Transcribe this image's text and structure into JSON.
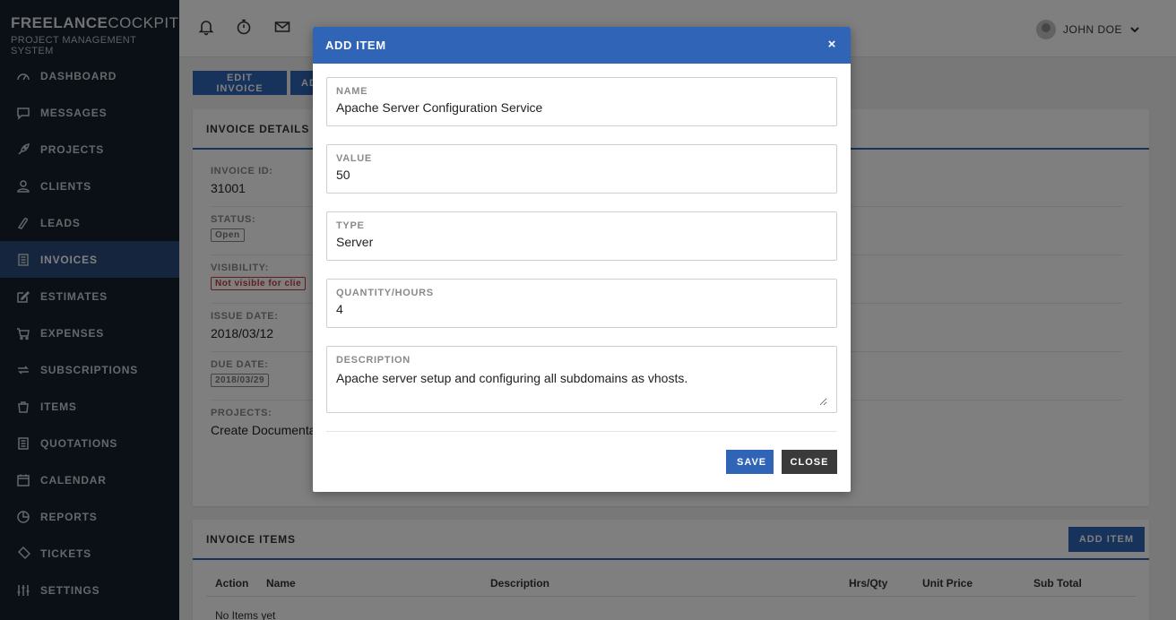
{
  "brand": {
    "title_bold": "FREELANCE",
    "title_rest": "COCKPIT",
    "subtitle": "PROJECT MANAGEMENT SYSTEM"
  },
  "sidebar": {
    "items": [
      {
        "label": "DASHBOARD",
        "icon": "gauge-icon"
      },
      {
        "label": "MESSAGES",
        "icon": "message-icon"
      },
      {
        "label": "PROJECTS",
        "icon": "rocket-icon"
      },
      {
        "label": "CLIENTS",
        "icon": "user-icon"
      },
      {
        "label": "LEADS",
        "icon": "leads-icon"
      },
      {
        "label": "INVOICES",
        "icon": "invoice-icon",
        "active": true
      },
      {
        "label": "ESTIMATES",
        "icon": "edit-icon"
      },
      {
        "label": "EXPENSES",
        "icon": "cart-icon"
      },
      {
        "label": "SUBSCRIPTIONS",
        "icon": "repeat-icon"
      },
      {
        "label": "ITEMS",
        "icon": "bag-icon"
      },
      {
        "label": "QUOTATIONS",
        "icon": "document-icon"
      },
      {
        "label": "CALENDAR",
        "icon": "calendar-icon"
      },
      {
        "label": "REPORTS",
        "icon": "chart-icon"
      },
      {
        "label": "TICKETS",
        "icon": "ticket-icon"
      },
      {
        "label": "SETTINGS",
        "icon": "sliders-icon"
      }
    ]
  },
  "topbar": {
    "user_name": "JOHN DOE"
  },
  "toolbar": {
    "edit_invoice": "EDIT INVOICE",
    "add_partial": "AD"
  },
  "details": {
    "header": "INVOICE DETAILS",
    "invoice_id_label": "INVOICE ID:",
    "invoice_id": "31001",
    "status_label": "STATUS:",
    "status": "Open",
    "visibility_label": "VISIBILITY:",
    "visibility": "Not visible for clie",
    "issue_date_label": "ISSUE DATE:",
    "issue_date": "2018/03/12",
    "due_date_label": "DUE DATE:",
    "due_date": "2018/03/29",
    "projects_label": "PROJECTS:",
    "projects": "Create Documenta"
  },
  "invoice_items": {
    "header": "INVOICE ITEMS",
    "add_item": "ADD ITEM",
    "columns": [
      "Action",
      "Name",
      "Description",
      "Hrs/Qty",
      "Unit Price",
      "Sub Total"
    ],
    "empty": "No Items yet"
  },
  "modal": {
    "title": "ADD ITEM",
    "close_x": "×",
    "name_label": "NAME",
    "name_value": "Apache Server Configuration Service",
    "value_label": "VALUE",
    "value_value": "50",
    "type_label": "TYPE",
    "type_value": "Server",
    "qty_label": "QUANTITY/HOURS",
    "qty_value": "4",
    "desc_label": "DESCRIPTION",
    "desc_value": "Apache server setup and configuring all subdomains as vhosts.",
    "save": "SAVE",
    "close": "CLOSE"
  },
  "colors": {
    "primary": "#2f64b7",
    "sidebar": "#17212d",
    "active": "#2b4a7d",
    "danger": "#c23b3b"
  }
}
